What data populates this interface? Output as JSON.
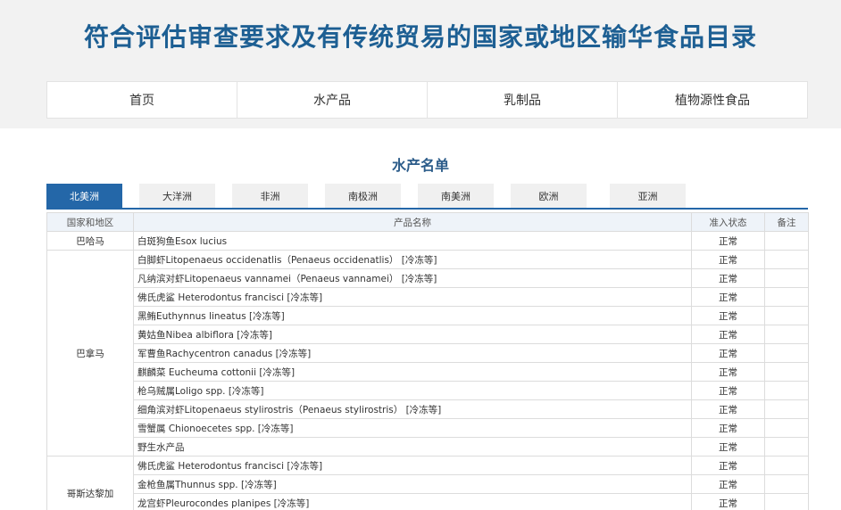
{
  "header": {
    "title": "符合评估审查要求及有传统贸易的国家或地区输华食品目录"
  },
  "nav": {
    "items": [
      "首页",
      "水产品",
      "乳制品",
      "植物源性食品"
    ]
  },
  "section": {
    "title": "水产名单"
  },
  "tabs": {
    "items": [
      "北美洲",
      "大洋洲",
      "非洲",
      "南极洲",
      "南美洲",
      "欧洲",
      "亚洲"
    ],
    "active": "北美洲"
  },
  "table": {
    "headers": [
      "国家和地区",
      "产品名称",
      "准入状态",
      "备注"
    ],
    "groups": [
      {
        "country": "巴哈马",
        "rows": [
          {
            "product": "白斑狗鱼Esox lucius",
            "status": "正常",
            "note": ""
          }
        ]
      },
      {
        "country": "巴拿马",
        "rows": [
          {
            "product": "白脚虾Litopenaeus occidenatlis（Penaeus occidenatlis） [冷冻等]",
            "status": "正常",
            "note": ""
          },
          {
            "product": "凡纳滨对虾Litopenaeus vannamei（Penaeus vannamei） [冷冻等]",
            "status": "正常",
            "note": ""
          },
          {
            "product": "佛氏虎鲨 Heterodontus francisci [冷冻等]",
            "status": "正常",
            "note": ""
          },
          {
            "product": "黑鲔Euthynnus lineatus [冷冻等]",
            "status": "正常",
            "note": ""
          },
          {
            "product": "黄姑鱼Nibea albiflora [冷冻等]",
            "status": "正常",
            "note": ""
          },
          {
            "product": "军曹鱼Rachycentron canadus [冷冻等]",
            "status": "正常",
            "note": ""
          },
          {
            "product": "麒麟菜 Eucheuma cottonii [冷冻等]",
            "status": "正常",
            "note": ""
          },
          {
            "product": "枪乌贼属Loligo spp. [冷冻等]",
            "status": "正常",
            "note": ""
          },
          {
            "product": "细角滨对虾Litopenaeus stylirostris（Penaeus stylirostris） [冷冻等]",
            "status": "正常",
            "note": ""
          },
          {
            "product": "雪蟹属 Chionoecetes spp. [冷冻等]",
            "status": "正常",
            "note": ""
          },
          {
            "product": "野生水产品",
            "status": "正常",
            "note": ""
          }
        ]
      },
      {
        "country": "哥斯达黎加",
        "rows": [
          {
            "product": "佛氏虎鲨 Heterodontus francisci [冷冻等]",
            "status": "正常",
            "note": ""
          },
          {
            "product": "金枪鱼属Thunnus spp. [冷冻等]",
            "status": "正常",
            "note": ""
          },
          {
            "product": "龙宫虾Pleurocondes planipes [冷冻等]",
            "status": "正常",
            "note": ""
          },
          {
            "product": "",
            "status": "",
            "note": ""
          }
        ]
      }
    ]
  }
}
